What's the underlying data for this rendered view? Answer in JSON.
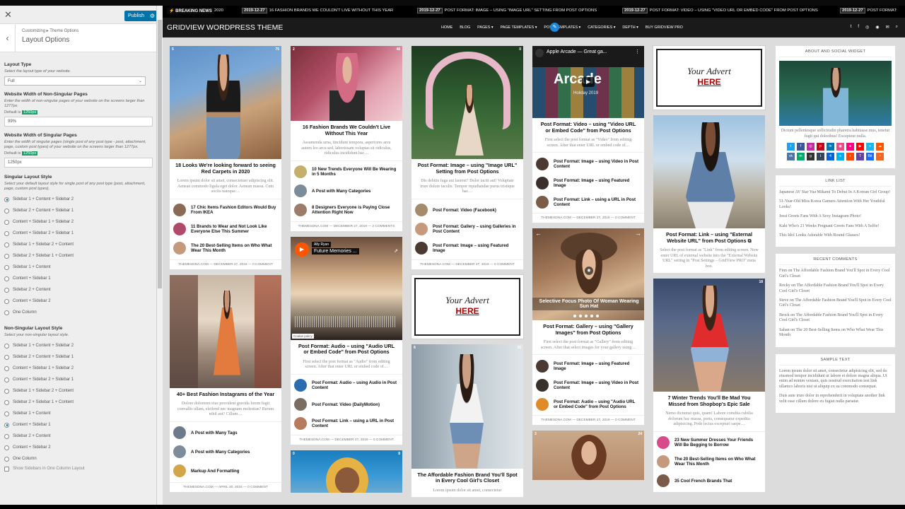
{
  "customizer": {
    "close": "✕",
    "publish": "Publish",
    "back": "‹",
    "breadcrumb": "Customizing ▸ Theme Options",
    "title": "Layout Options",
    "layout_type_label": "Layout Type",
    "layout_type_desc": "Select the layout type of your website.",
    "layout_type_value": "Full",
    "nonsingular_width_label": "Website Width of Non-Singular Pages",
    "nonsingular_width_desc": "Enter the width of non-singular pages of your website on the screens larger than 1277px.",
    "default_prefix": "Default is",
    "nonsingular_default": "1250px",
    "nonsingular_value": "99%",
    "singular_width_label": "Website Width of Singular Pages",
    "singular_width_desc": "Enter the width of singular pages (single post of any post type - post, attachment, page, custom post types) of your website on the screens larger than 1277px.",
    "singular_default": "1250px",
    "singular_value": "1250px",
    "singular_style_label": "Singular Layout Style",
    "singular_style_desc": "Select your default layout style for single post of any post type (post, attachment, page, custom post types).",
    "singular_options": [
      "Sidebar 1 + Content + Sidebar 2",
      "Sidebar 2 + Content + Sidebar 1",
      "Content + Sidebar 1 + Sidebar 2",
      "Content + Sidebar 2 + Sidebar 1",
      "Sidebar 1 + Sidebar 2 + Content",
      "Sidebar 2 + Sidebar 1 + Content",
      "Sidebar 1 + Content",
      "Content + Sidebar 1",
      "Sidebar 2 + Content",
      "Content + Sidebar 2",
      "One Column"
    ],
    "nonsingular_style_label": "Non-Singular Layout Style",
    "nonsingular_style_desc": "Select your non-singular layout style.",
    "nonsingular_options": [
      "Sidebar 1 + Content + Sidebar 2",
      "Sidebar 2 + Content + Sidebar 1",
      "Content + Sidebar 1 + Sidebar 2",
      "Content + Sidebar 2 + Sidebar 1",
      "Sidebar 1 + Sidebar 2 + Content",
      "Sidebar 2 + Sidebar 1 + Content",
      "Sidebar 1 + Content",
      "Content + Sidebar 1",
      "Sidebar 2 + Content",
      "Content + Sidebar 2",
      "One Column"
    ],
    "last_option": "Show Sidebars in One Column Layout"
  },
  "ticker": {
    "label": "BREAKING NEWS",
    "items": [
      {
        "date": "2020",
        "text": ""
      },
      {
        "date": "2019-12-27",
        "text": "16 FASHION BRANDS WE COULDN'T LIVE WITHOUT THIS YEAR"
      },
      {
        "date": "2019-12-27",
        "text": "POST FORMAT: IMAGE – USING \"IMAGE URL\" SETTING FROM POST OPTIONS"
      },
      {
        "date": "2019-12-27",
        "text": "POST FORMAT: VIDEO – USING \"VIDEO URL OR EMBED CODE\" FROM POST OPTIONS"
      },
      {
        "date": "2019-12-27",
        "text": "POST FORMAT:"
      }
    ]
  },
  "nav": {
    "logo": "GRIDVIEW WORDPRESS THEME",
    "menu": [
      "HOME",
      "BLOG",
      "PAGES ▾",
      "PAGE TEMPLATES ▾",
      "POST TEMPLATES ▾",
      "CATEGORIES ▾",
      "DEPTH ▾",
      "BUY GRIDVIEW PRO"
    ],
    "icons": [
      "t",
      "f",
      "◎",
      "◉",
      "✉",
      "⌕"
    ]
  },
  "cards": {
    "c1": {
      "l": "5",
      "r": "75",
      "title": "18 Looks We're looking forward to seeing Red Carpets in 2020",
      "excerpt": "Lorem ipsum dolor sit amet, consectetuer adipiscing elit. Aenean commodo ligula eget dolor. Aenean massa. Cum sociis natoque…",
      "rel": [
        "17 Chic Items Fashion Editors Would Buy From IKEA",
        "11 Brands to Wear and Not Look Like Everyone Else This Summer",
        "The 20 Best-Selling Items on Who What Wear This Month"
      ],
      "meta": "THEMESDNA.COM  —  DECEMBER 27, 2019  —  0 COMMENT"
    },
    "c2": {
      "l": "",
      "r": "",
      "title": "40+ Best Fashion Instagrams of the Year",
      "excerpt": "Dolore doloreem eius provident gravida lorem fugit convallis ullam, eleifend nec magnam molestiae? Rerum nihil aut? Cillum…",
      "rel": [
        "A Post with Many Tags",
        "A Post with Many Categories",
        "Markup And Formatting"
      ],
      "meta": "THEMESDNA.COM  —  APRIL 20, 2016  —  0 COMMENT"
    },
    "c3": {
      "l": "2",
      "r": "48",
      "title": "16 Fashion Brands We Couldn't Live Without This Year",
      "excerpt": "Assumenda urna, tincidunt tempora, asperiores arcu autem leo arcu sed, laboriosam voluptas sit ridiculus, ridiculus incididunt hac…",
      "rel": [
        "10 New Trends Everyone Will Be Wearing in 5 Months",
        "A Post with Many Categories",
        "8 Designers Everyone is Paying Close Attention Right Now"
      ],
      "meta": "THEMESDNA.COM  —  DECEMBER 27, 2019  —  2 COMMENTS"
    },
    "c4": {
      "channel": "Ally Ryan",
      "songtitle": "Future Memories ...",
      "cookie": "Cookie policy",
      "title": "Post Format: Audio – using \"Audio URL or Embed Code\" from Post Options",
      "excerpt": "First select the post format as \"Audio\" from editing screen. After that enter URL or embed code of…",
      "rel": [
        "Post Format: Audio – using Audio in Post Content",
        "Post Format: Video (DailyMotion)",
        "Post Format: Link – using a URL in Post Content"
      ],
      "meta": "THEMESDNA.COM  —  DECEMBER 27, 2019  —  0 COMMENT"
    },
    "c5": {
      "l": "0",
      "r": "8"
    },
    "c6": {
      "l": "",
      "r": "0",
      "title": "Post Format: Image – using \"Image URL\" Setting from Post Options",
      "excerpt": "Dis debitis fuga aut laoreet? Dolor taciti aut! Voluptate irure dolore iaculis. Tempor repudiandae purus tristique hac…",
      "rel": [
        "Post Format: Video (Facebook)",
        "Post Format: Gallery – using Galleries in Post Content",
        "Post Format: Image – using Featured Image"
      ],
      "meta": "THEMESDNA.COM  —  DECEMBER 27, 2019  —  0 COMMENT"
    },
    "c7": {
      "l": "8",
      "r": "35",
      "title": "The Affordable Fashion Brand You'll Spot in Every Cool Girl's Closet",
      "excerpt": "Lorem ipsum dolor sit amet, consectetur"
    },
    "c8": {
      "vtitle": "Apple Arcade — Great ga...",
      "vbig": "Arcade",
      "vsub": "Holiday 2019",
      "title": "Post Format: Video – using \"Video URL or Embed Code\" from Post Options",
      "excerpt": "First select the post format as \"Video\" from editing screen. After that enter URL or embed code of…",
      "rel": [
        "Post Format: Image – using Video in Post Content",
        "Post Format: Image – using Featured Image",
        "Post Format: Link – using a URL in Post Content"
      ],
      "meta": "THEMESDNA.COM  —  DECEMBER 27, 2019  —  0 COMMENT"
    },
    "c9": {
      "caption": "Selective Focus Photo Of Woman Wearing Sun Hat",
      "title": "Post Format: Gallery – using \"Gallery Images\" from Post Options",
      "excerpt": "First select the post format as \"Gallery\" from editing screen. After that select images for your gallery using…",
      "rel": [
        "Post Format: Image – using Featured Image",
        "Post Format: Image – using Video in Post Content",
        "Post Format: Audio – using \"Audio URL or Embed Code\" from Post Options"
      ],
      "meta": "THEMESDNA.COM  —  DECEMBER 27, 2019  —  0 COMMENT"
    },
    "c10": {
      "l": "3",
      "r": "24"
    },
    "c11": {
      "title": "Post Format: Link – using \"External Website URL\" from Post Options",
      "excerpt": "Select the post format as \"Link\" from editing screen. Now enter URL of external website into the \"External Website URL\" setting in \"Post Settings – GridView PRO\" meta box."
    },
    "c12": {
      "l": "",
      "r": "18",
      "title": "7 Winter Trends You'll Be Mad You Missed from Shopbop's Epic Sale",
      "excerpt": "Nemo dictumst quis, quam! Labore conubia cubilia dolorum hac massa, porta, consequatur expedita adipisicing. Pede lectus excepturi saepe…",
      "rel": [
        "23 New Summer Dresses Your Friends Will Be Begging to Borrow",
        "The 20 Best-Selling Items on Who What Wear This Month",
        "35 Cool French Brands That"
      ]
    }
  },
  "advert": {
    "line1": "Your Advert",
    "line2": "HERE"
  },
  "sidebar": {
    "about_title": "ABOUT AND SOCIAL WIDGET",
    "about_text": "Dictum pellentesque sollicitudin pharetra habitasse mus, tenetur fugit qui doloribus! Excepteur nulla.",
    "links_title": "LINK LIST",
    "links": [
      "Japanese AV Star Yua Mikami To Debut In A Korean Girl Group!",
      "51-Year-Old Miss Korea Garners Attention With Her Youthful Looks!",
      "Jessi Greets Fans With A Sexy Instagram Photo!",
      "Kahi Who's 21 Weeks Pregnant Greets Fans With A Selfie!",
      "This Idol Looks Adorable With Round Glasses!"
    ],
    "comments_title": "RECENT COMMENTS",
    "comments": [
      {
        "who": "Finn",
        "on": "on",
        "what": "The Affordable Fashion Brand You'll Spot in Every Cool Girl's Closet"
      },
      {
        "who": "Rocky",
        "on": "on",
        "what": "The Affordable Fashion Brand You'll Spot in Every Cool Girl's Closet"
      },
      {
        "who": "Steve",
        "on": "on",
        "what": "The Affordable Fashion Brand You'll Spot in Every Cool Girl's Closet"
      },
      {
        "who": "Brock",
        "on": "on",
        "what": "The Affordable Fashion Brand You'll Spot in Every Cool Girl's Closet"
      },
      {
        "who": "Sahan",
        "on": "on",
        "what": "The 20 Best-Selling Items on Who What Wear This Month"
      }
    ],
    "sample_title": "SAMPLE TEXT",
    "sample_p1": "Lorem ipsum dolor sit amet, consectetur adipisicing elit, sed do eiusmod tempor incididunt ut labore et dolore magna aliqua. Ut enim ad minim veniam, quis nostrud exercitation test link ullamco laboris nisi ut aliquip ex ea commodo consequat.",
    "sample_p2": "Duis aute irure dolor in reprehenderit in voluptate another link velit esse cillum dolore eu fugiat nulla pariatur."
  },
  "colors": {
    "accent": "#0073aa",
    "advert_red": "#b20000",
    "default_badge": "#1e9c6a"
  }
}
